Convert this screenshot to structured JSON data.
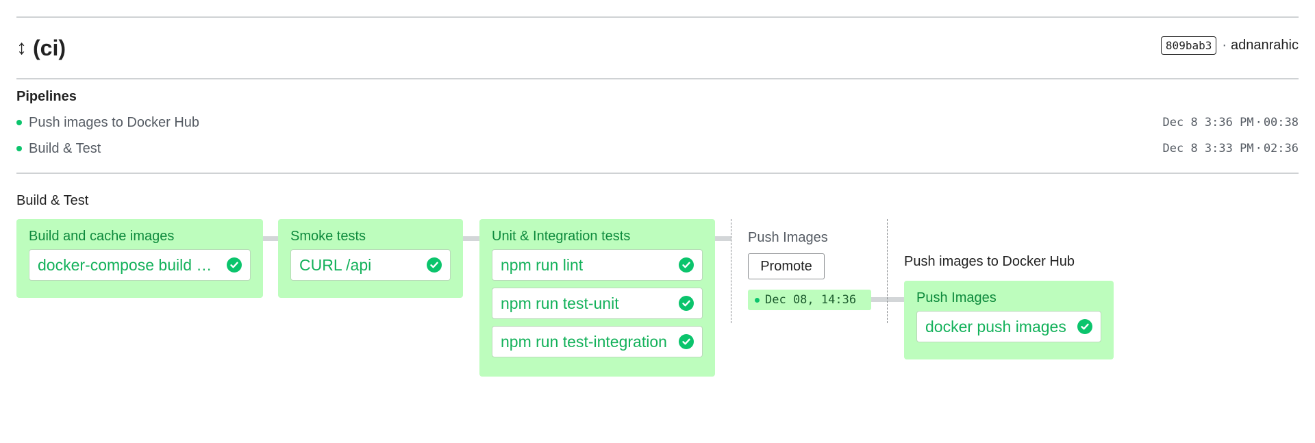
{
  "header": {
    "arrow_icon": "↕",
    "title": "(ci)",
    "commit_hash": "809bab3",
    "author_sep": "·",
    "author": "adnanrahic"
  },
  "pipelines": {
    "heading": "Pipelines",
    "items": [
      {
        "name": "Push images to Docker Hub",
        "date": "Dec 8 3:36 PM",
        "sep": "·",
        "duration": "00:38",
        "status_color": "#0bc46c"
      },
      {
        "name": "Build & Test",
        "date": "Dec 8 3:33 PM",
        "sep": "·",
        "duration": "02:36",
        "status_color": "#0bc46c"
      }
    ]
  },
  "workflow": {
    "label": "Build & Test",
    "blocks": [
      {
        "title": "Build and cache images",
        "jobs": [
          "docker-compose build …"
        ]
      },
      {
        "title": "Smoke tests",
        "jobs": [
          "CURL /api"
        ]
      },
      {
        "title": "Unit & Integration tests",
        "jobs": [
          "npm run lint",
          "npm run test-unit",
          "npm run test-integration"
        ]
      }
    ],
    "promotion": {
      "title": "Push Images",
      "button_label": "Promote",
      "date": "Dec 08, 14:36"
    },
    "downstream": {
      "pipeline_title": "Push images to Docker Hub",
      "block_title": "Push Images",
      "jobs": [
        "docker push images"
      ]
    }
  },
  "colors": {
    "block_bg": "#bdfdbd",
    "success": "#0bc46c",
    "job_text": "#13b15a",
    "block_title": "#0d8a3c"
  }
}
